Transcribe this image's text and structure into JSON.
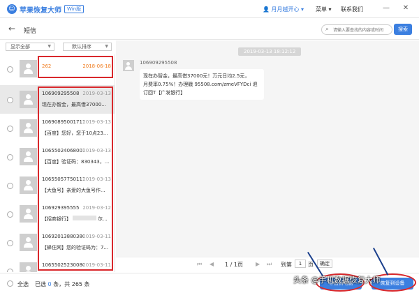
{
  "app": {
    "name": "苹果恢复大师",
    "edition": "Win版",
    "user": "月月越开心",
    "menu": "菜单",
    "contact": "联系我们"
  },
  "header": {
    "title": "短信",
    "search_placeholder": "请输入要查找的内容或时间",
    "search_button": "搜索"
  },
  "filters": {
    "show": "显示全部",
    "sort": "默认排序"
  },
  "conversations": [
    {
      "number": "262",
      "date": "2018-06-18",
      "preview": "",
      "highlight": true
    },
    {
      "number": "106909295508",
      "date": "2019-03-13",
      "preview": "现在办智金，最高借37000..."
    },
    {
      "number": "10690895001711",
      "date": "2019-03-13",
      "preview": "【百度】您好，您于10点23..."
    },
    {
      "number": "10655024068001",
      "date": "2019-03-13",
      "preview": "【百度】验证码：830343，..."
    },
    {
      "number": "10655057750111",
      "date": "2019-03-13",
      "preview": "【大鱼号】亲爱的大鱼号作..."
    },
    {
      "number": "106929395555",
      "date": "2019-03-12",
      "preview": "【招商银行】",
      "tail": "尔..."
    },
    {
      "number": "10692013880380",
      "date": "2019-03-11",
      "preview": "【蜂住网】您的验证码为：7..."
    },
    {
      "number": "10655025230080",
      "date": "2019-03-11",
      "preview": ""
    }
  ],
  "message": {
    "timestamp": "2019-03-13 18:12:12",
    "sender": "106909295508",
    "lines": [
      "现在办智金，最高借37000元！万元日均2.5元，",
      "月费率0.75%！办理戳 95508.com/zmeVFYDci 退",
      "订回T【广发银行】"
    ]
  },
  "pager": {
    "first": "⏮",
    "prev": "◀",
    "info": "1 / 1页",
    "next": "▶",
    "last": "⏭",
    "jump": "到第",
    "page_value": "1",
    "page_unit": "页",
    "confirm": "确定"
  },
  "footer": {
    "select_all": "全选",
    "selected_prefix": "已选",
    "selected_count": "0",
    "total": "条，共 265 条",
    "export_label": "导出到电脑",
    "recover_label": "恢复到设备"
  },
  "watermark": "头条 @手机数据恢复大师"
}
